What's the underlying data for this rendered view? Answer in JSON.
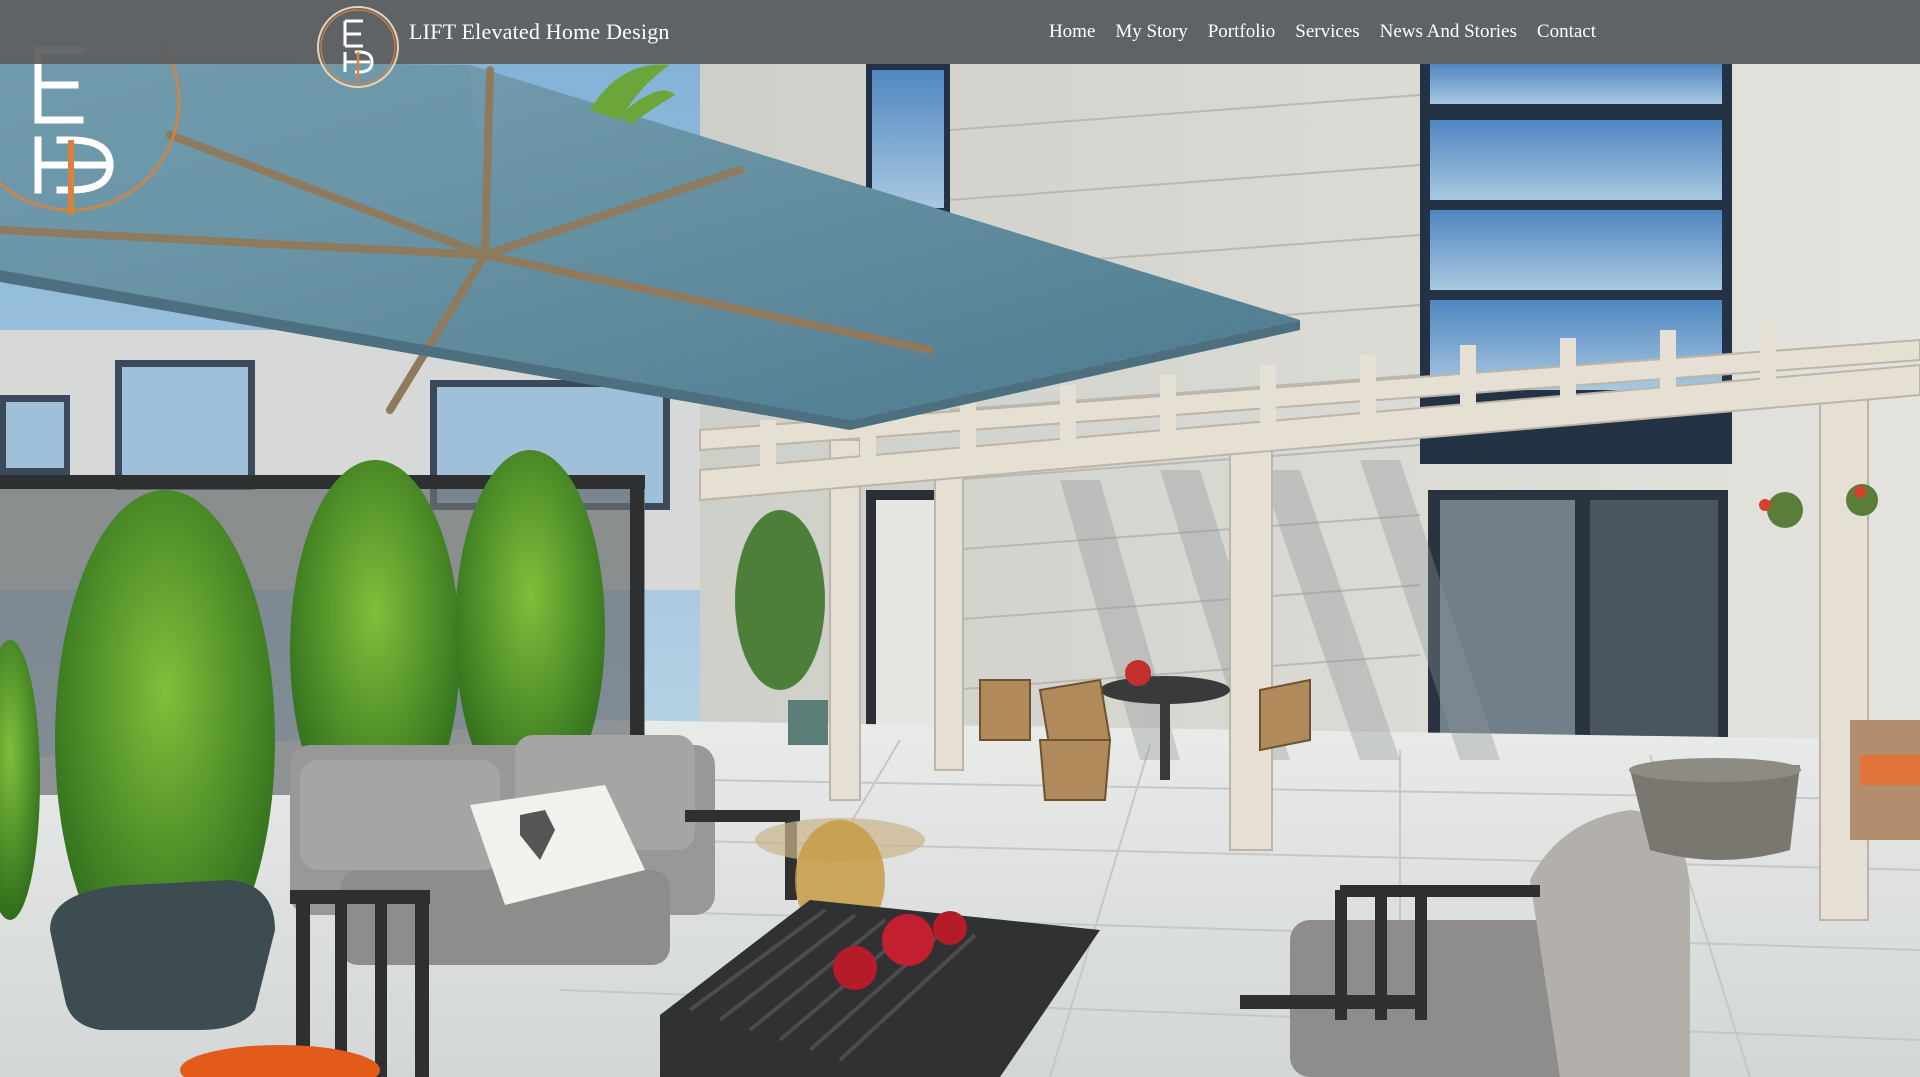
{
  "header": {
    "brand_name": "LIFT Elevated Home Design",
    "logo_icon": "lehd-monogram-logo"
  },
  "nav": {
    "items": [
      {
        "label": "Home"
      },
      {
        "label": "My Story"
      },
      {
        "label": "Portfolio"
      },
      {
        "label": "Services"
      },
      {
        "label": "News And Stories"
      },
      {
        "label": "Contact"
      }
    ]
  },
  "hero": {
    "image_icon": "rooftop-patio-photo"
  },
  "colors": {
    "header_bg": "#5c5c5c",
    "nav_text": "#ffffff",
    "logo_accent": "#d9823b",
    "umbrella": "#5f8ea0",
    "sky": "#7fb0d6"
  }
}
